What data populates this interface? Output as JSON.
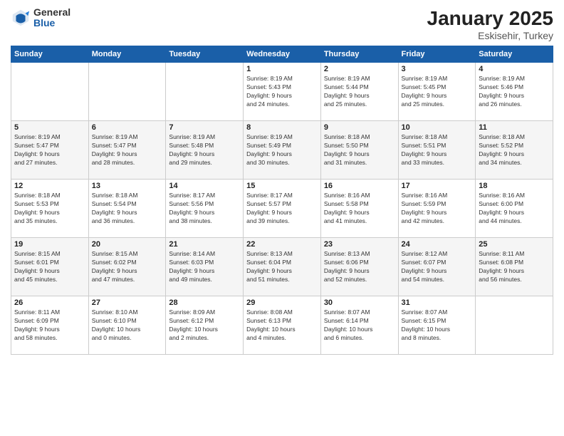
{
  "logo": {
    "general": "General",
    "blue": "Blue"
  },
  "title": "January 2025",
  "location": "Eskisehir, Turkey",
  "weekdays": [
    "Sunday",
    "Monday",
    "Tuesday",
    "Wednesday",
    "Thursday",
    "Friday",
    "Saturday"
  ],
  "weeks": [
    [
      {
        "day": "",
        "info": ""
      },
      {
        "day": "",
        "info": ""
      },
      {
        "day": "",
        "info": ""
      },
      {
        "day": "1",
        "info": "Sunrise: 8:19 AM\nSunset: 5:43 PM\nDaylight: 9 hours\nand 24 minutes."
      },
      {
        "day": "2",
        "info": "Sunrise: 8:19 AM\nSunset: 5:44 PM\nDaylight: 9 hours\nand 25 minutes."
      },
      {
        "day": "3",
        "info": "Sunrise: 8:19 AM\nSunset: 5:45 PM\nDaylight: 9 hours\nand 25 minutes."
      },
      {
        "day": "4",
        "info": "Sunrise: 8:19 AM\nSunset: 5:46 PM\nDaylight: 9 hours\nand 26 minutes."
      }
    ],
    [
      {
        "day": "5",
        "info": "Sunrise: 8:19 AM\nSunset: 5:47 PM\nDaylight: 9 hours\nand 27 minutes."
      },
      {
        "day": "6",
        "info": "Sunrise: 8:19 AM\nSunset: 5:47 PM\nDaylight: 9 hours\nand 28 minutes."
      },
      {
        "day": "7",
        "info": "Sunrise: 8:19 AM\nSunset: 5:48 PM\nDaylight: 9 hours\nand 29 minutes."
      },
      {
        "day": "8",
        "info": "Sunrise: 8:19 AM\nSunset: 5:49 PM\nDaylight: 9 hours\nand 30 minutes."
      },
      {
        "day": "9",
        "info": "Sunrise: 8:18 AM\nSunset: 5:50 PM\nDaylight: 9 hours\nand 31 minutes."
      },
      {
        "day": "10",
        "info": "Sunrise: 8:18 AM\nSunset: 5:51 PM\nDaylight: 9 hours\nand 33 minutes."
      },
      {
        "day": "11",
        "info": "Sunrise: 8:18 AM\nSunset: 5:52 PM\nDaylight: 9 hours\nand 34 minutes."
      }
    ],
    [
      {
        "day": "12",
        "info": "Sunrise: 8:18 AM\nSunset: 5:53 PM\nDaylight: 9 hours\nand 35 minutes."
      },
      {
        "day": "13",
        "info": "Sunrise: 8:18 AM\nSunset: 5:54 PM\nDaylight: 9 hours\nand 36 minutes."
      },
      {
        "day": "14",
        "info": "Sunrise: 8:17 AM\nSunset: 5:56 PM\nDaylight: 9 hours\nand 38 minutes."
      },
      {
        "day": "15",
        "info": "Sunrise: 8:17 AM\nSunset: 5:57 PM\nDaylight: 9 hours\nand 39 minutes."
      },
      {
        "day": "16",
        "info": "Sunrise: 8:16 AM\nSunset: 5:58 PM\nDaylight: 9 hours\nand 41 minutes."
      },
      {
        "day": "17",
        "info": "Sunrise: 8:16 AM\nSunset: 5:59 PM\nDaylight: 9 hours\nand 42 minutes."
      },
      {
        "day": "18",
        "info": "Sunrise: 8:16 AM\nSunset: 6:00 PM\nDaylight: 9 hours\nand 44 minutes."
      }
    ],
    [
      {
        "day": "19",
        "info": "Sunrise: 8:15 AM\nSunset: 6:01 PM\nDaylight: 9 hours\nand 45 minutes."
      },
      {
        "day": "20",
        "info": "Sunrise: 8:15 AM\nSunset: 6:02 PM\nDaylight: 9 hours\nand 47 minutes."
      },
      {
        "day": "21",
        "info": "Sunrise: 8:14 AM\nSunset: 6:03 PM\nDaylight: 9 hours\nand 49 minutes."
      },
      {
        "day": "22",
        "info": "Sunrise: 8:13 AM\nSunset: 6:04 PM\nDaylight: 9 hours\nand 51 minutes."
      },
      {
        "day": "23",
        "info": "Sunrise: 8:13 AM\nSunset: 6:06 PM\nDaylight: 9 hours\nand 52 minutes."
      },
      {
        "day": "24",
        "info": "Sunrise: 8:12 AM\nSunset: 6:07 PM\nDaylight: 9 hours\nand 54 minutes."
      },
      {
        "day": "25",
        "info": "Sunrise: 8:11 AM\nSunset: 6:08 PM\nDaylight: 9 hours\nand 56 minutes."
      }
    ],
    [
      {
        "day": "26",
        "info": "Sunrise: 8:11 AM\nSunset: 6:09 PM\nDaylight: 9 hours\nand 58 minutes."
      },
      {
        "day": "27",
        "info": "Sunrise: 8:10 AM\nSunset: 6:10 PM\nDaylight: 10 hours\nand 0 minutes."
      },
      {
        "day": "28",
        "info": "Sunrise: 8:09 AM\nSunset: 6:12 PM\nDaylight: 10 hours\nand 2 minutes."
      },
      {
        "day": "29",
        "info": "Sunrise: 8:08 AM\nSunset: 6:13 PM\nDaylight: 10 hours\nand 4 minutes."
      },
      {
        "day": "30",
        "info": "Sunrise: 8:07 AM\nSunset: 6:14 PM\nDaylight: 10 hours\nand 6 minutes."
      },
      {
        "day": "31",
        "info": "Sunrise: 8:07 AM\nSunset: 6:15 PM\nDaylight: 10 hours\nand 8 minutes."
      },
      {
        "day": "",
        "info": ""
      }
    ]
  ]
}
